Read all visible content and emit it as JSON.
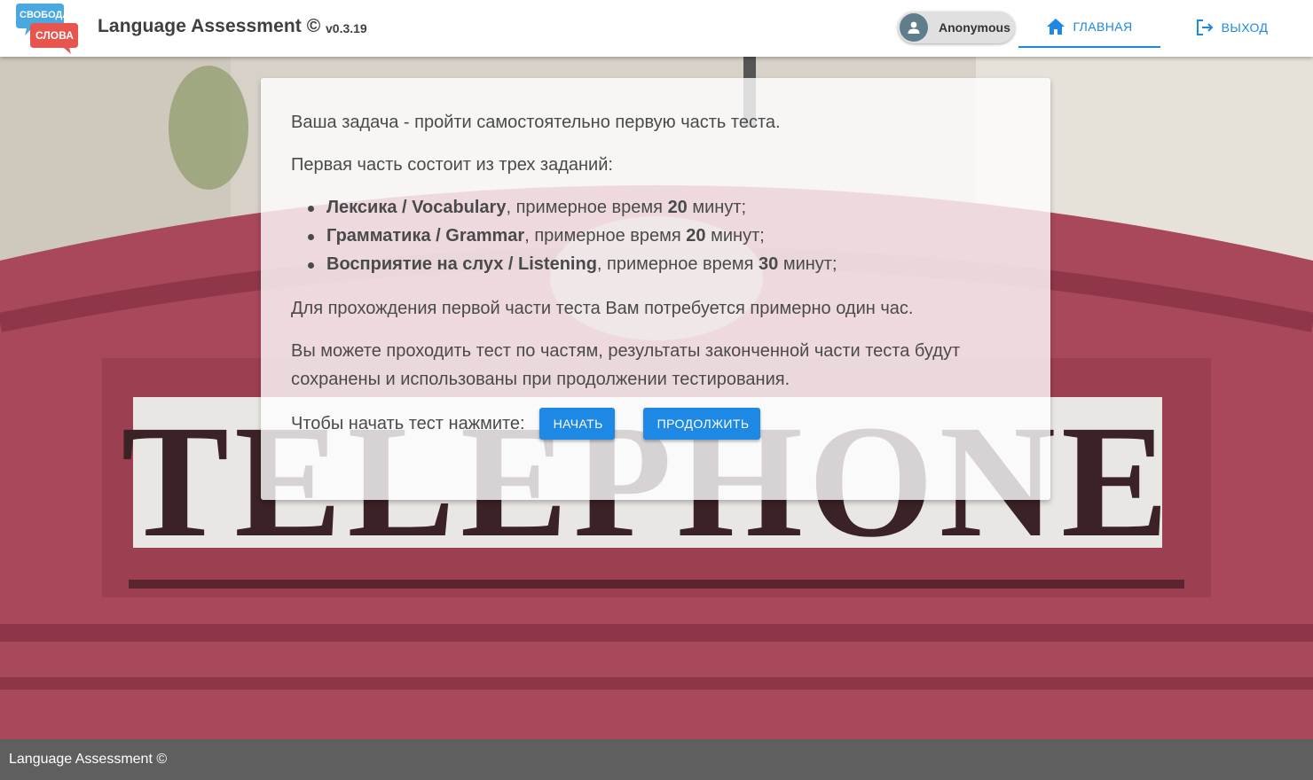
{
  "header": {
    "logo_text_top": "СВОБОДА",
    "logo_text_bottom": "СЛОВА",
    "title": "Language Assessment ©",
    "version": "v0.3.19",
    "user_name": "Anonymous",
    "nav": {
      "home_label": "ГЛАВНАЯ",
      "home_icon": "home-icon",
      "logout_label": "ВЫХОД",
      "logout_icon": "logout-icon"
    }
  },
  "background": {
    "sign_text": "TELEPHONE"
  },
  "card": {
    "intro": "Ваша задача - пройти самостоятельно первую часть теста.",
    "parts_intro": "Первая часть состоит из трех заданий:",
    "items": [
      {
        "name": "Лексика / Vocabulary",
        "text_before": ", примерное время ",
        "minutes": "20",
        "text_after": " минут;"
      },
      {
        "name": "Грамматика / Grammar",
        "text_before": ", примерное время ",
        "minutes": "20",
        "text_after": " минут;"
      },
      {
        "name": "Восприятие на слух / Listening",
        "text_before": ", примерное время ",
        "minutes": "30",
        "text_after": " минут;"
      }
    ],
    "duration_note": "Для прохождения первой части теста Вам потребуется примерно один час.",
    "parts_note": "Вы можете проходить тест по частям, результаты законченной части теста будут сохранены и использованы при продолжении тестирования.",
    "start_prompt": "Чтобы начать тест нажмите:",
    "start_button": "НАЧАТЬ",
    "continue_button": "ПРОДОЛЖИТЬ"
  },
  "footer": {
    "text": "Language Assessment ©"
  },
  "colors": {
    "accent": "#1e88e5",
    "footer_bg": "#5f5f5f",
    "avatar_bg": "#607d8b"
  }
}
